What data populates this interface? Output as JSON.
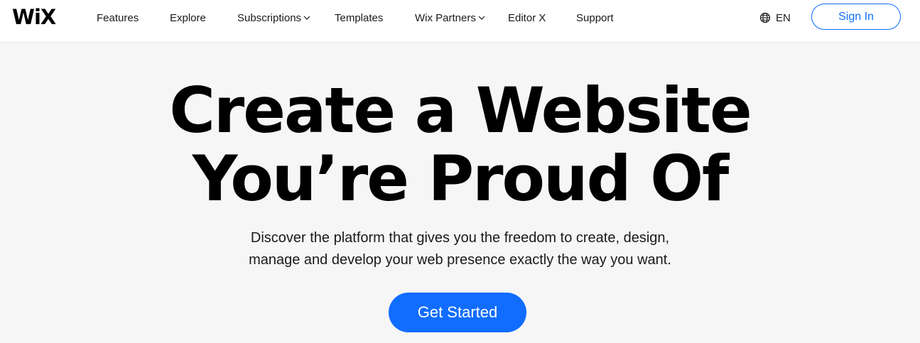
{
  "brand": {
    "logo_text": "WiX"
  },
  "nav": {
    "items": [
      {
        "label": "Features"
      },
      {
        "label": "Explore"
      },
      {
        "label": "Subscriptions",
        "has_dropdown": true
      },
      {
        "label": "Templates"
      },
      {
        "label": "Wix Partners",
        "has_dropdown": true
      },
      {
        "label": "Editor X"
      },
      {
        "label": "Support"
      }
    ],
    "language": {
      "label": "EN",
      "icon": "globe-icon"
    },
    "sign_in_label": "Sign In"
  },
  "hero": {
    "title_line1": "Create a Website",
    "title_line2": "You’re Proud Of",
    "subtitle_line1": "Discover the platform that gives you the freedom to create, design,",
    "subtitle_line2": "manage and develop your web presence exactly the way you want.",
    "cta_label": "Get Started"
  },
  "colors": {
    "accent": "#116dff",
    "background": "#f6f6f6",
    "header_background": "#ffffff"
  }
}
